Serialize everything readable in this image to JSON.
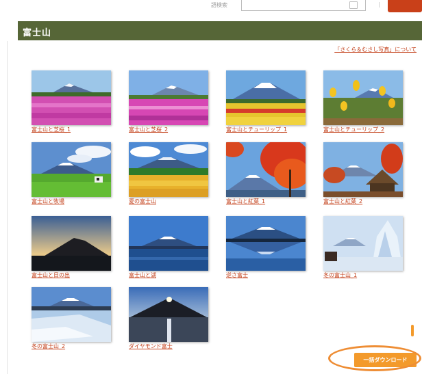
{
  "header": {
    "search_label": "語検索",
    "search_value": "",
    "separator": "|"
  },
  "page_title": "富士山",
  "about_link": "「さくら＆むさし写真」について",
  "photos": [
    {
      "caption": "富士山と芝桜_1",
      "icon": "fuji-shibazakura-photo"
    },
    {
      "caption": "富士山と芝桜_2",
      "icon": "fuji-shibazakura-photo"
    },
    {
      "caption": "富士山とチューリップ_1",
      "icon": "fuji-tulip-photo"
    },
    {
      "caption": "富士山とチューリップ_2",
      "icon": "fuji-tulip-photo"
    },
    {
      "caption": "富士山と牧場",
      "icon": "fuji-pasture-photo"
    },
    {
      "caption": "夏の富士山",
      "icon": "fuji-summer-photo"
    },
    {
      "caption": "富士山と紅葉_1",
      "icon": "fuji-autumn-leaves-photo"
    },
    {
      "caption": "富士山と紅葉_2",
      "icon": "fuji-autumn-leaves-photo"
    },
    {
      "caption": "富士山と日の出",
      "icon": "fuji-sunrise-photo"
    },
    {
      "caption": "富士山と湖",
      "icon": "fuji-lake-photo"
    },
    {
      "caption": "逆さ富士",
      "icon": "fuji-reflection-photo"
    },
    {
      "caption": "冬の富士山_1",
      "icon": "fuji-winter-photo"
    },
    {
      "caption": "冬の富士山_2",
      "icon": "fuji-winter-photo"
    },
    {
      "caption": "ダイヤモンド富士",
      "icon": "diamond-fuji-photo"
    }
  ],
  "download_button": "一括ダウンロード",
  "colors": {
    "title_bar": "#566637",
    "link": "#c4431e",
    "accent_orange": "#f39a2b",
    "search_button": "#c94019"
  }
}
